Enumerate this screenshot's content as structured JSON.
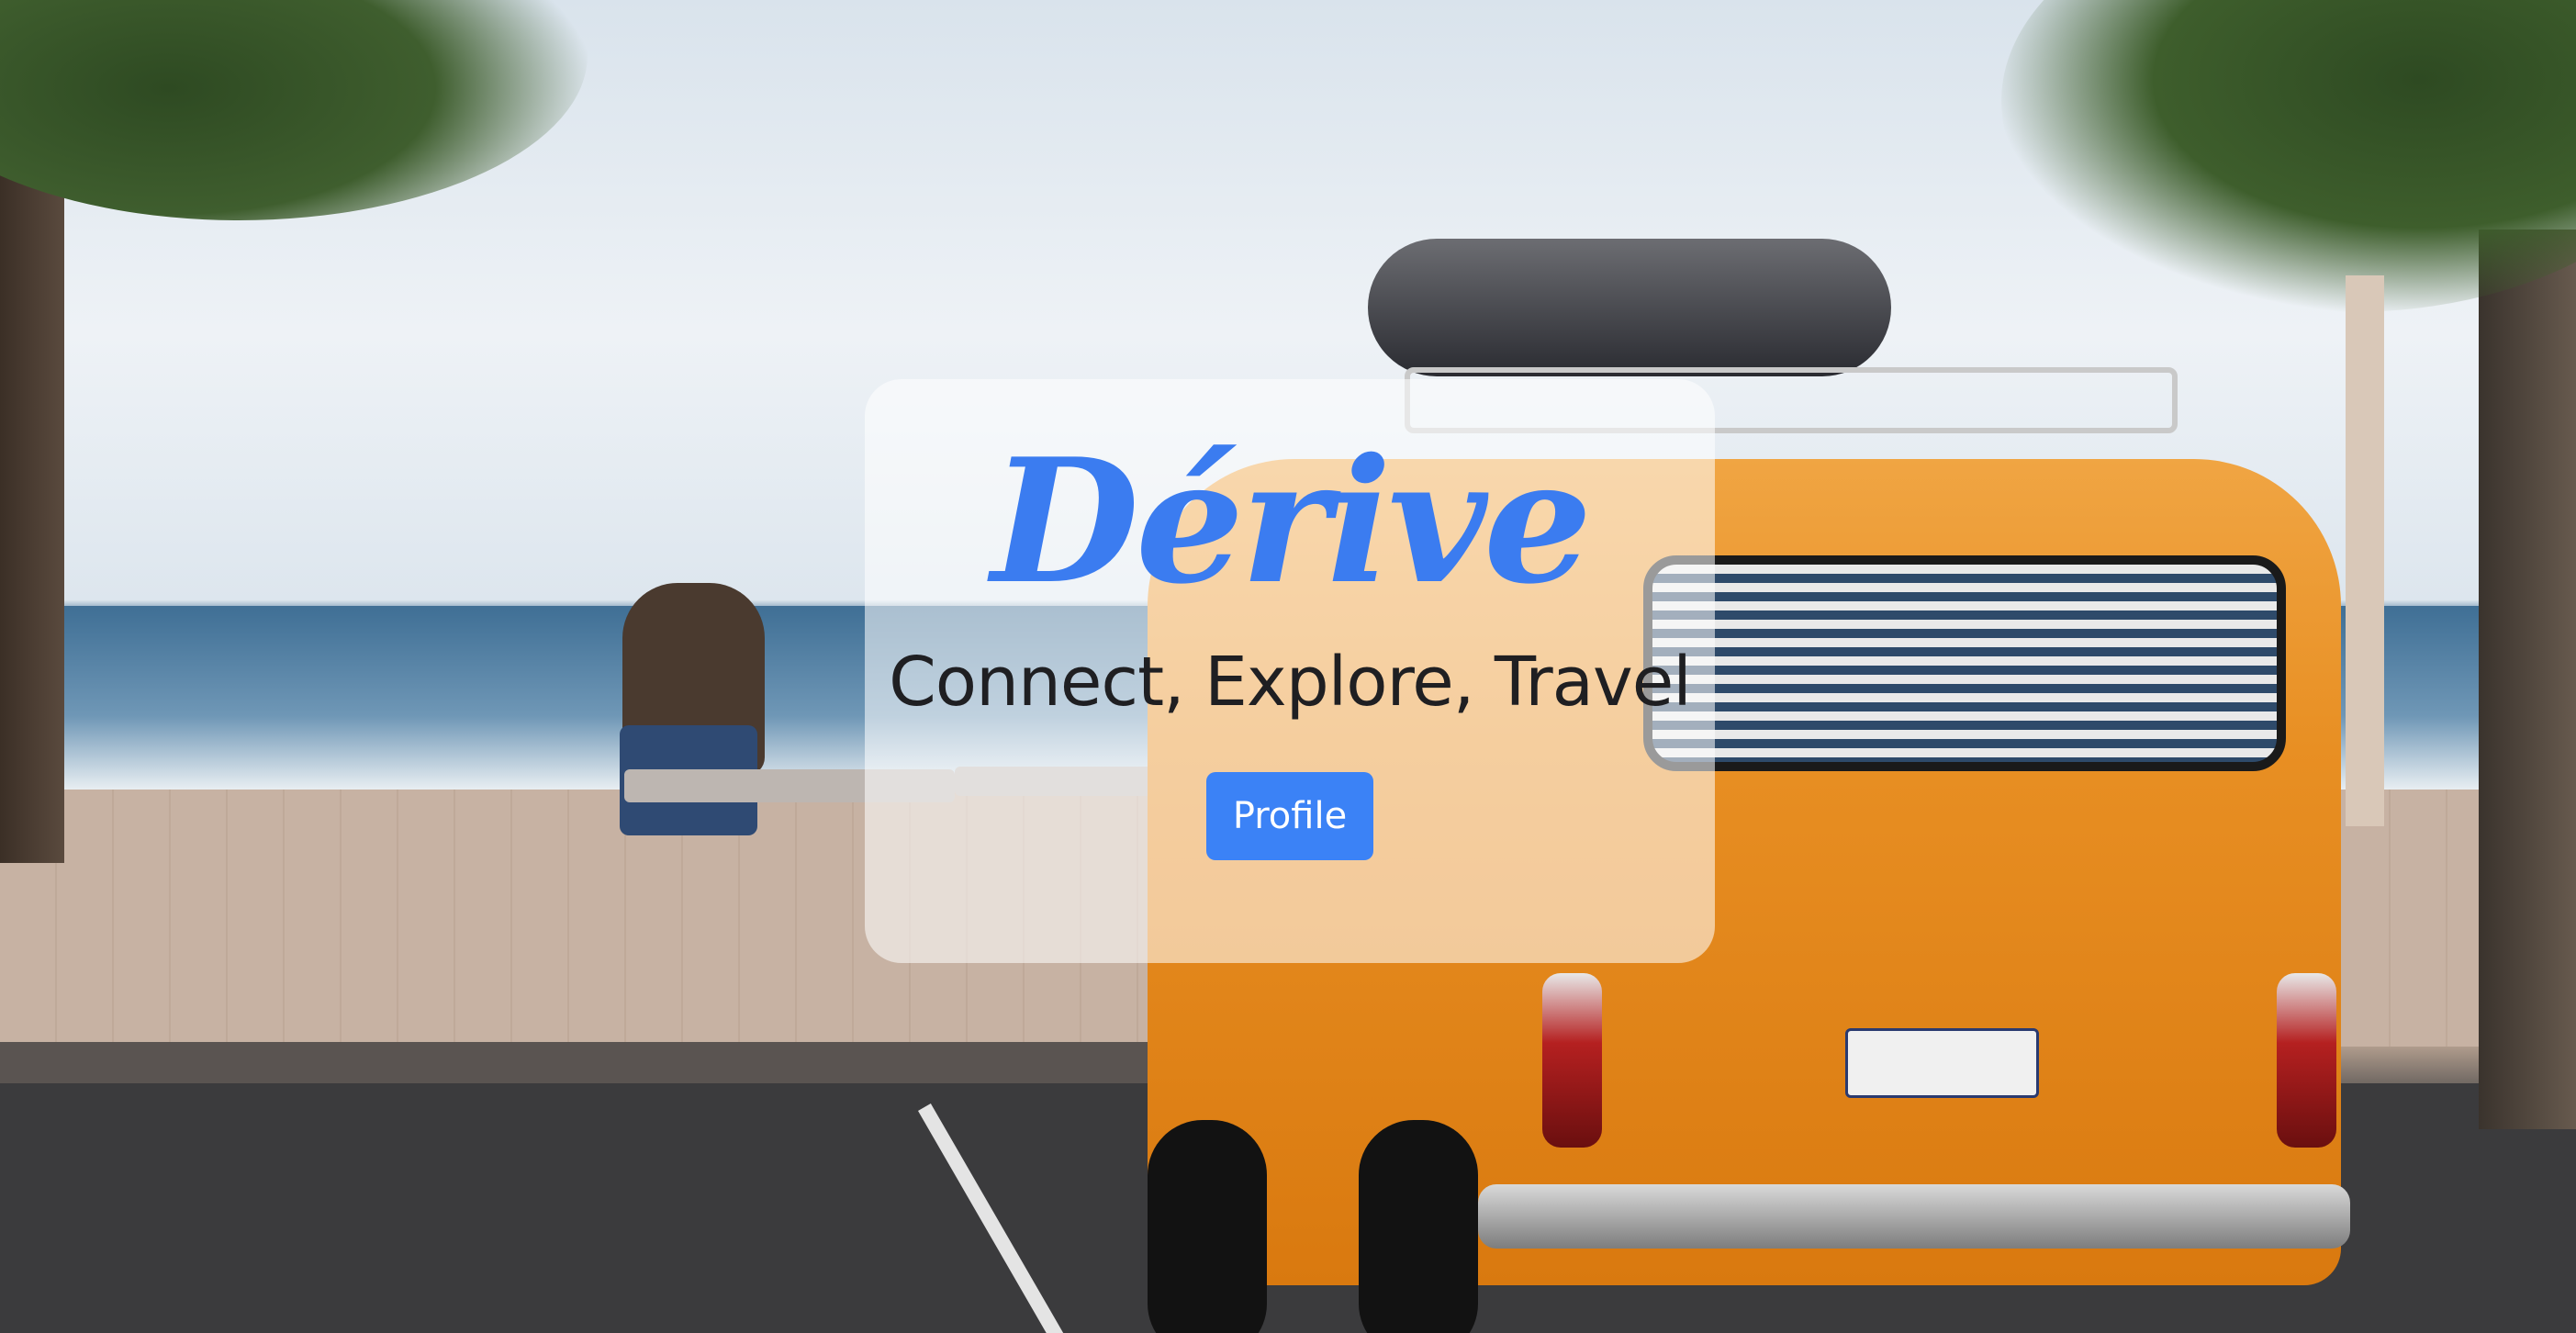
{
  "hero": {
    "brand_title": "Dérive",
    "tagline": "Connect, Explore, Travel",
    "profile_button_label": "Profile"
  },
  "colors": {
    "accent": "#3b7cf0",
    "button": "#3b82f6"
  }
}
